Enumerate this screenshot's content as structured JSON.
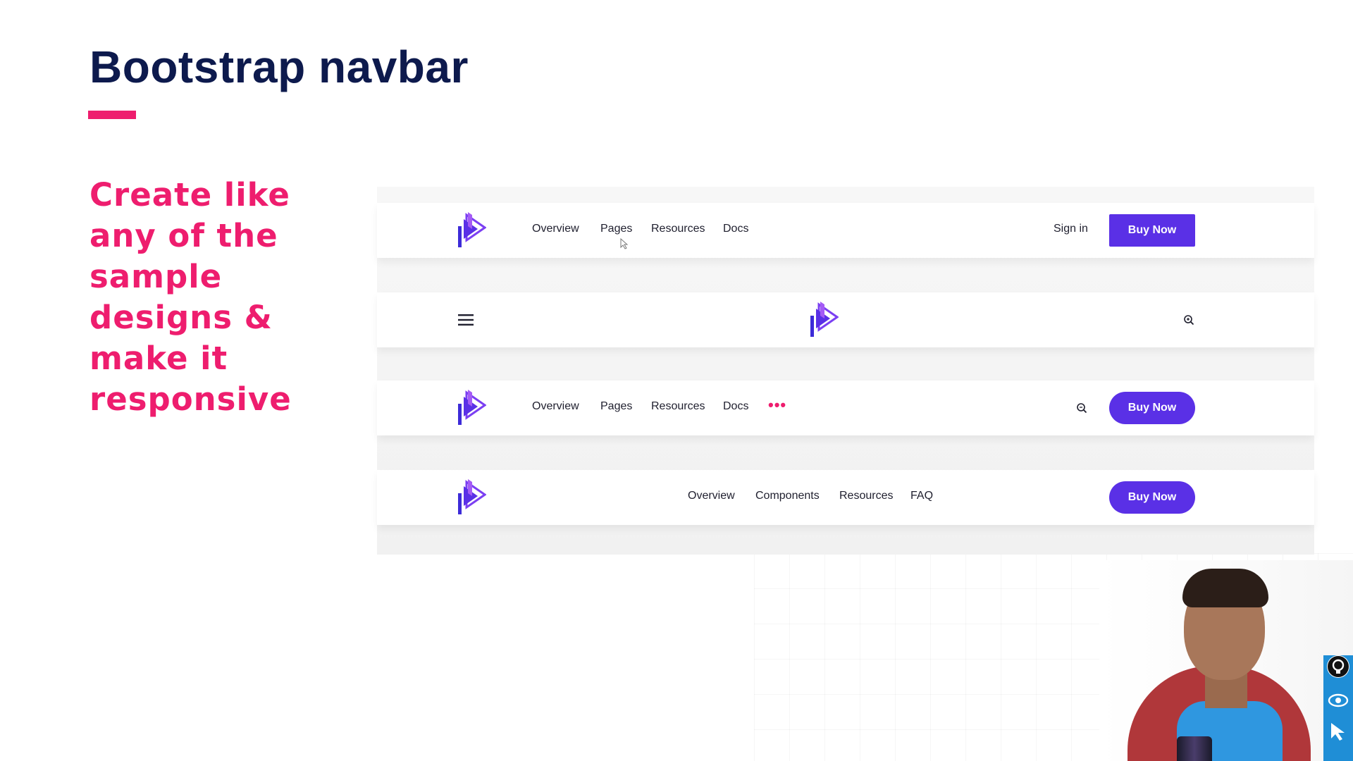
{
  "slide": {
    "title": "Bootstrap navbar",
    "instructions": "Create like any of the sample designs & make it responsive",
    "accent_color": "#ee1d6e",
    "title_color": "#0d1a4d"
  },
  "brand": {
    "primary_color": "#5a30e6",
    "logo_icon": "play-brand-logo-icon"
  },
  "navbar1": {
    "links": [
      "Overview",
      "Pages",
      "Resources",
      "Docs"
    ],
    "signin_label": "Sign in",
    "cta_label": "Buy Now"
  },
  "navbar2": {
    "menu_icon": "hamburger-icon",
    "search_icon": "search-icon"
  },
  "navbar3": {
    "links": [
      "Overview",
      "Pages",
      "Resources",
      "Docs"
    ],
    "more_icon": "more-dots-icon",
    "search_icon": "search-icon",
    "cta_label": "Buy Now"
  },
  "navbar4": {
    "links": [
      "Overview",
      "Components",
      "Resources",
      "FAQ"
    ],
    "cta_label": "Buy Now"
  },
  "overlay": {
    "tool_icons": [
      "bulb-icon",
      "eye-icon",
      "cursor-icon"
    ]
  }
}
